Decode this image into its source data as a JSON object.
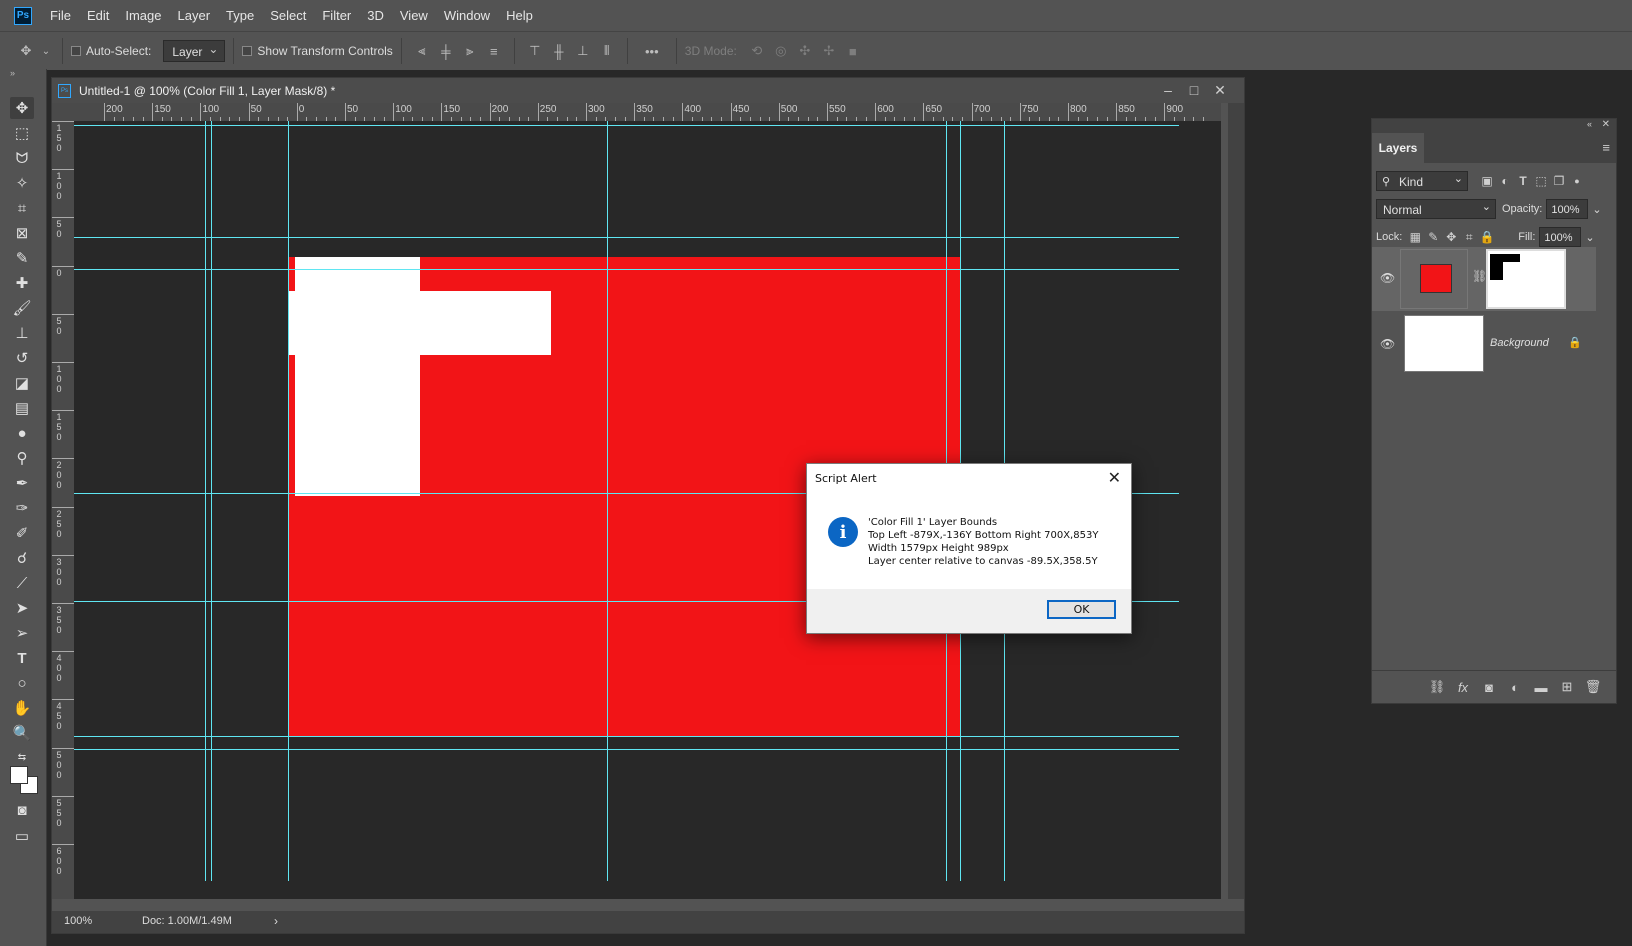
{
  "app": {
    "logo": "Ps",
    "menu": [
      "File",
      "Edit",
      "Image",
      "Layer",
      "Type",
      "Select",
      "Filter",
      "3D",
      "View",
      "Window",
      "Help"
    ]
  },
  "options": {
    "auto_select_label": "Auto-Select:",
    "auto_select_value": "Layer",
    "show_transform_label": "Show Transform Controls",
    "mode_3d_label": "3D Mode:",
    "more": "•••"
  },
  "document": {
    "title": "Untitled-1 @ 100% (Color Fill 1, Layer Mask/8) *",
    "zoom": "100%",
    "doc_size": "Doc: 1.00M/1.49M",
    "status_arrow": "›",
    "ruler_top_labels": [
      "200",
      "150",
      "100",
      "50",
      "0",
      "50",
      "100",
      "150",
      "200",
      "250",
      "300",
      "350",
      "400",
      "450",
      "500",
      "550",
      "600",
      "650",
      "700",
      "750",
      "800",
      "850",
      "900"
    ],
    "ruler_left_labels": [
      "1\n5\n0",
      "1\n0\n0",
      "5\n0",
      "0",
      "5\n0",
      "1\n0\n0",
      "1\n5\n0",
      "2\n0\n0",
      "2\n5\n0",
      "3\n0\n0",
      "3\n5\n0",
      "4\n0\n0",
      "4\n5\n0",
      "5\n0\n0",
      "5\n5\n0",
      "6\n0\n0"
    ]
  },
  "dialog": {
    "title": "Script Alert",
    "close": "✕",
    "icon": "i",
    "lines": [
      "'Color Fill 1' Layer Bounds",
      "Top Left -879X,-136Y   Bottom Right 700X,853Y",
      "Width 1579px   Height 989px",
      "Layer center relative to canvas -89.5X,358.5Y"
    ],
    "ok": "OK"
  },
  "layers": {
    "tab": "Layers",
    "kind": "Kind",
    "blend_mode": "Normal",
    "opacity_label": "Opacity:",
    "opacity_value": "100%",
    "lock_label": "Lock:",
    "fill_label": "Fill:",
    "fill_value": "100%",
    "background_name": "Background"
  },
  "colors": {
    "fill_layer": "#f21417",
    "guides": "#5fe6f2",
    "accent": "#31a8ff"
  }
}
